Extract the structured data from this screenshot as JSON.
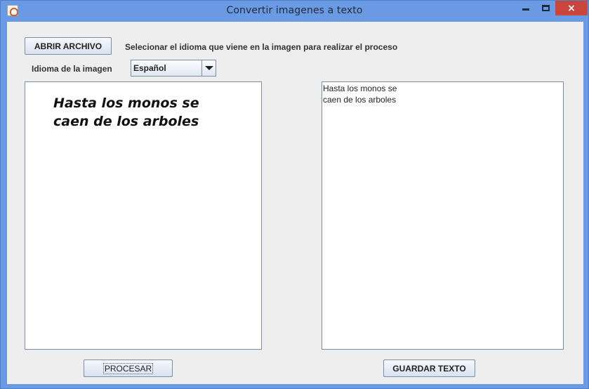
{
  "window": {
    "title": "Convertir imagenes a texto",
    "controls": {
      "minimize": "minimize-icon",
      "maximize": "maximize-icon",
      "close": "×"
    }
  },
  "toolbar": {
    "open_file_label": "ABRIR ARCHIVO",
    "instructions": "Selecionar el idioma que viene en la imagen para realizar el proceso"
  },
  "language": {
    "label": "Idioma de la imagen",
    "selected": "Español"
  },
  "image_preview": {
    "lines": [
      "Hasta los monos se",
      "caen de los arboles"
    ]
  },
  "ocr_output": {
    "lines": [
      "Hasta los monos se",
      "caen de los arboles"
    ]
  },
  "actions": {
    "process_label": "PROCESAR",
    "save_label": "GUARDAR TEXTO"
  },
  "colors": {
    "titlebar": "#6a9ae4",
    "close": "#c9463d",
    "client_bg": "#eeeeee"
  }
}
